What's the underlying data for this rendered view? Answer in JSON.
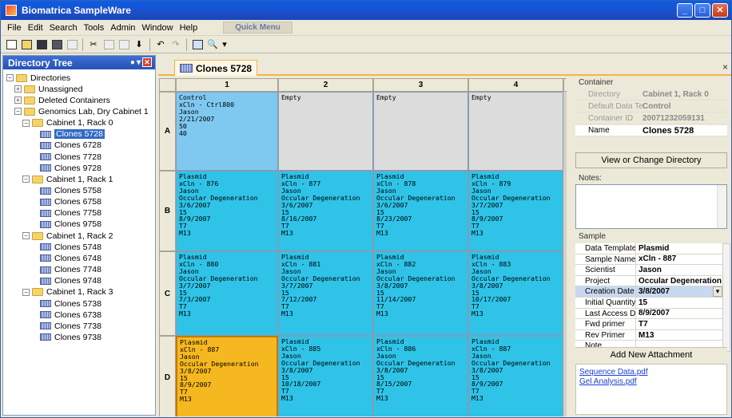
{
  "app": {
    "title": "Biomatrica SampleWare"
  },
  "menu": {
    "items": [
      "File",
      "Edit",
      "Search",
      "Tools",
      "Admin",
      "Window",
      "Help"
    ],
    "quick_menu": "Quick Menu"
  },
  "toolbar": {
    "icons": [
      "new-file-icon",
      "open-folder-icon",
      "save-icon",
      "save-all-icon",
      "print-icon",
      "cut-icon",
      "copy-icon",
      "paste-icon",
      "import-icon",
      "undo-icon",
      "redo-icon",
      "grid-view-icon",
      "zoom-icon"
    ]
  },
  "directory_tree": {
    "title": "Directory Tree",
    "nodes": [
      {
        "label": "Directories",
        "level": 0,
        "expander": "−",
        "icon": "folder"
      },
      {
        "label": "Unassigned",
        "level": 1,
        "expander": "+",
        "icon": "folder"
      },
      {
        "label": "Deleted Containers",
        "level": 1,
        "expander": "+",
        "icon": "folder"
      },
      {
        "label": "Genomics Lab, Dry Cabinet 1",
        "level": 1,
        "expander": "−",
        "icon": "folder"
      },
      {
        "label": "Cabinet 1, Rack 0",
        "level": 2,
        "expander": "−",
        "icon": "folder"
      },
      {
        "label": "Clones 5728",
        "level": 3,
        "icon": "clone",
        "selected": true
      },
      {
        "label": "Clones 6728",
        "level": 3,
        "icon": "clone"
      },
      {
        "label": "Clones 7728",
        "level": 3,
        "icon": "clone"
      },
      {
        "label": "Clones 9728",
        "level": 3,
        "icon": "clone"
      },
      {
        "label": "Cabinet 1, Rack 1",
        "level": 2,
        "expander": "−",
        "icon": "folder"
      },
      {
        "label": "Clones 5758",
        "level": 3,
        "icon": "clone"
      },
      {
        "label": "Clones 6758",
        "level": 3,
        "icon": "clone"
      },
      {
        "label": "Clones 7758",
        "level": 3,
        "icon": "clone"
      },
      {
        "label": "Clones 9758",
        "level": 3,
        "icon": "clone"
      },
      {
        "label": "Cabinet 1, Rack 2",
        "level": 2,
        "expander": "−",
        "icon": "folder"
      },
      {
        "label": "Clones 5748",
        "level": 3,
        "icon": "clone"
      },
      {
        "label": "Clones 6748",
        "level": 3,
        "icon": "clone"
      },
      {
        "label": "Clones 7748",
        "level": 3,
        "icon": "clone"
      },
      {
        "label": "Clones 9748",
        "level": 3,
        "icon": "clone"
      },
      {
        "label": "Cabinet 1, Rack 3",
        "level": 2,
        "expander": "−",
        "icon": "folder"
      },
      {
        "label": "Clones 5738",
        "level": 3,
        "icon": "clone"
      },
      {
        "label": "Clones 6738",
        "level": 3,
        "icon": "clone"
      },
      {
        "label": "Clones 7738",
        "level": 3,
        "icon": "clone"
      },
      {
        "label": "Clones 9738",
        "level": 3,
        "icon": "clone"
      }
    ]
  },
  "tab": {
    "label": "Clones 5728",
    "close": "×"
  },
  "grid": {
    "columns": [
      "1",
      "2",
      "3",
      "4"
    ],
    "rows": [
      {
        "label": "A",
        "cells": [
          {
            "type": "control",
            "lines": [
              "Control",
              "xCln - Ctrl800",
              "Jason",
              "2/21/2007",
              "50",
              "40"
            ]
          },
          {
            "type": "empty",
            "lines": [
              "Empty"
            ]
          },
          {
            "type": "empty",
            "lines": [
              "Empty"
            ]
          },
          {
            "type": "empty",
            "lines": [
              "Empty"
            ]
          }
        ]
      },
      {
        "label": "B",
        "cells": [
          {
            "type": "plasmid",
            "lines": [
              "Plasmid",
              "xCln - 876",
              "Jason",
              "Occular Degeneration",
              "3/6/2007",
              "15",
              "8/9/2007",
              "T7",
              "M13"
            ]
          },
          {
            "type": "plasmid",
            "lines": [
              "Plasmid",
              "xCln - 877",
              "Jason",
              "Occular Degeneration",
              "3/6/2007",
              "15",
              "8/16/2007",
              "T7",
              "M13"
            ]
          },
          {
            "type": "plasmid",
            "lines": [
              "Plasmid",
              "xCln - 878",
              "Jason",
              "Occular Degeneration",
              "3/6/2007",
              "15",
              "8/23/2007",
              "T7",
              "M13"
            ]
          },
          {
            "type": "plasmid",
            "lines": [
              "Plasmid",
              "xCln - 879",
              "Jason",
              "Occular Degeneration",
              "3/7/2007",
              "15",
              "8/9/2007",
              "T7",
              "M13"
            ]
          }
        ]
      },
      {
        "label": "C",
        "cells": [
          {
            "type": "plasmid",
            "lines": [
              "Plasmid",
              "xCln - 880",
              "Jason",
              "Occular Degeneration",
              "3/7/2007",
              "15",
              "7/3/2007",
              "T7",
              "M13"
            ]
          },
          {
            "type": "plasmid",
            "lines": [
              "Plasmid",
              "xCln - 881",
              "Jason",
              "Occular Degeneration",
              "3/7/2007",
              "15",
              "7/12/2007",
              "T7",
              "M13"
            ]
          },
          {
            "type": "plasmid",
            "lines": [
              "Plasmid",
              "xCln - 882",
              "Jason",
              "Occular Degeneration",
              "3/8/2007",
              "15",
              "11/14/2007",
              "T7",
              "M13"
            ]
          },
          {
            "type": "plasmid",
            "lines": [
              "Plasmid",
              "xCln - 883",
              "Jason",
              "Occular Degeneration",
              "3/8/2007",
              "15",
              "10/17/2007",
              "T7",
              "M13"
            ]
          }
        ]
      },
      {
        "label": "D",
        "cells": [
          {
            "type": "selected",
            "lines": [
              "Plasmid",
              "xCln - 887",
              "Jason",
              "Occular Degeneration",
              "3/8/2007",
              "15",
              "8/9/2007",
              "T7",
              "M13"
            ]
          },
          {
            "type": "plasmid",
            "lines": [
              "Plasmid",
              "xCln - 885",
              "Jason",
              "Occular Degeneration",
              "3/8/2007",
              "15",
              "10/18/2007",
              "T7",
              "M13"
            ]
          },
          {
            "type": "plasmid",
            "lines": [
              "Plasmid",
              "xCln - 886",
              "Jason",
              "Occular Degeneration",
              "3/8/2007",
              "15",
              "8/15/2007",
              "T7",
              "M13"
            ]
          },
          {
            "type": "plasmid",
            "lines": [
              "Plasmid",
              "xCln - 887",
              "Jason",
              "Occular Degeneration",
              "3/8/2007",
              "15",
              "8/9/2007",
              "T7",
              "M13"
            ]
          }
        ]
      }
    ]
  },
  "container": {
    "title": "Container",
    "fields": [
      {
        "key": "Directory",
        "value": "Cabinet 1, Rack 0"
      },
      {
        "key": "Default Data Template",
        "value": "Control"
      },
      {
        "key": "Container ID",
        "value": "20071232059131"
      },
      {
        "key": "Name",
        "value": "Clones 5728",
        "active": true
      }
    ],
    "change_dir_button": "View or Change Directory"
  },
  "notes": {
    "label": "Notes:"
  },
  "sample": {
    "title": "Sample",
    "fields": [
      {
        "key": "Data Template",
        "value": "Plasmid"
      },
      {
        "key": "Sample Name",
        "value": "xCln - 887"
      },
      {
        "key": "Scientist",
        "value": "Jason"
      },
      {
        "key": "Project",
        "value": "Occular Degeneration"
      },
      {
        "key": "Creation Date",
        "value": "3/8/2007",
        "highlight": true,
        "dropdown": true
      },
      {
        "key": "Initial Quantity (ul)",
        "value": "15"
      },
      {
        "key": "Last Access Date",
        "value": "8/9/2007"
      },
      {
        "key": "Fwd primer",
        "value": "T7"
      },
      {
        "key": "Rev Primer",
        "value": "M13"
      },
      {
        "key": "Note",
        "value": ""
      }
    ],
    "add_attachment_button": "Add New Attachment",
    "attachments": [
      "Sequence Data.pdf",
      "Gel Analysis.pdf"
    ]
  },
  "colors": {
    "plasmid": "#2fc3e8",
    "control": "#7fc9f1",
    "empty": "#dcdcdc",
    "selected": "#f6b820",
    "titlebar": "#0a5ee8"
  }
}
